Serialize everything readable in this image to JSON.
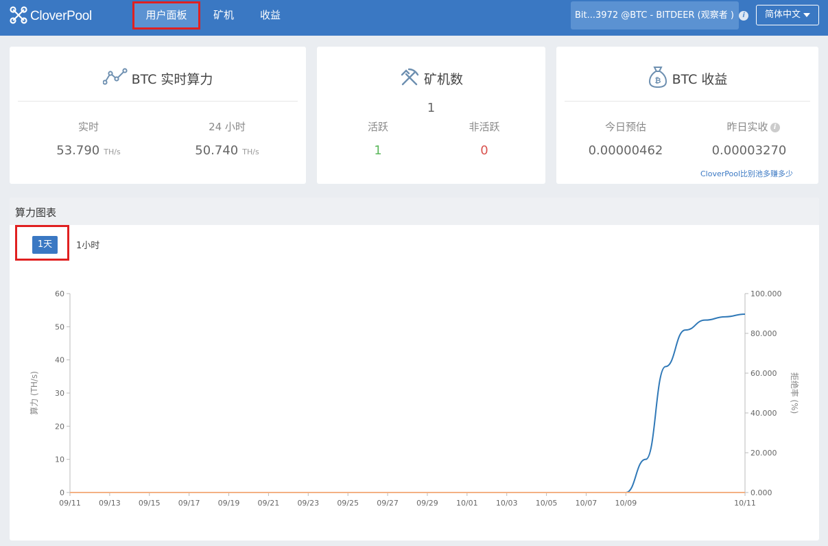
{
  "header": {
    "logo_text": "CloverPool",
    "nav": [
      {
        "label": "用户面板",
        "active": true
      },
      {
        "label": "矿机",
        "active": false
      },
      {
        "label": "收益",
        "active": false
      }
    ],
    "account_label": "Bit...3972 @BTC - BITDEER (观察者 )",
    "language": "简体中文"
  },
  "cards": {
    "hashrate": {
      "title": "BTC 实时算力",
      "realtime_label": "实时",
      "realtime_value": "53.790",
      "day_label": "24 小时",
      "day_value": "50.740",
      "unit": "TH/s"
    },
    "miners": {
      "title": "矿机数",
      "total": "1",
      "active_label": "活跃",
      "active_value": "1",
      "inactive_label": "非活跃",
      "inactive_value": "0"
    },
    "earnings": {
      "title": "BTC 收益",
      "today_label": "今日预估",
      "today_value": "0.00000462",
      "yesterday_label": "昨日实收",
      "yesterday_value": "0.00003270",
      "compare_link": "CloverPool比别池多赚多少"
    }
  },
  "chart_panel": {
    "title": "算力图表",
    "ranges": [
      {
        "label": "1天",
        "active": true
      },
      {
        "label": "1小时",
        "active": false
      }
    ]
  },
  "colors": {
    "brand": "#3a78c3",
    "active_green": "#5cb85c",
    "inactive_red": "#d9534f",
    "hashrate_line": "#2f78b7",
    "reject_line": "#f4b183"
  },
  "chart_data": {
    "type": "line",
    "x": [
      "09/11",
      "09/12",
      "09/13",
      "09/14",
      "09/15",
      "09/16",
      "09/17",
      "09/18",
      "09/19",
      "09/20",
      "09/21",
      "09/22",
      "09/23",
      "09/24",
      "09/25",
      "09/26",
      "09/27",
      "09/28",
      "09/29",
      "09/30",
      "10/01",
      "10/02",
      "10/03",
      "10/04",
      "10/05",
      "10/06",
      "10/07",
      "10/08",
      "10/09",
      "10/09",
      "10/09",
      "10/10",
      "10/10",
      "10/10",
      "10/11"
    ],
    "x_ticks": [
      "09/11",
      "09/13",
      "09/15",
      "09/17",
      "09/19",
      "09/21",
      "09/23",
      "09/25",
      "09/27",
      "09/29",
      "10/01",
      "10/03",
      "10/05",
      "10/07",
      "10/09",
      "10/11"
    ],
    "series": [
      {
        "axis": "left",
        "color": "#2f78b7",
        "values": [
          0,
          0,
          0,
          0,
          0,
          0,
          0,
          0,
          0,
          0,
          0,
          0,
          0,
          0,
          0,
          0,
          0,
          0,
          0,
          0,
          0,
          0,
          0,
          0,
          0,
          0,
          0,
          0,
          0,
          10,
          38,
          49,
          52,
          53,
          53.8
        ]
      },
      {
        "axis": "right",
        "color": "#f4b183",
        "values": [
          0,
          0,
          0,
          0,
          0,
          0,
          0,
          0,
          0,
          0,
          0,
          0,
          0,
          0,
          0,
          0,
          0,
          0,
          0,
          0,
          0,
          0,
          0,
          0,
          0,
          0,
          0,
          0,
          0,
          0,
          0,
          0,
          0,
          0,
          0
        ]
      }
    ],
    "ylabel": "算力 (TH/s)",
    "ylim": [
      0,
      60
    ],
    "y_ticks": [
      0,
      10,
      20,
      30,
      40,
      50,
      60
    ],
    "y2label": "拒绝率 (%)",
    "y2lim": [
      0,
      100
    ],
    "y2_ticks": [
      "0.000",
      "20.000",
      "40.000",
      "60.000",
      "80.000",
      "100.000"
    ],
    "grid": false
  }
}
